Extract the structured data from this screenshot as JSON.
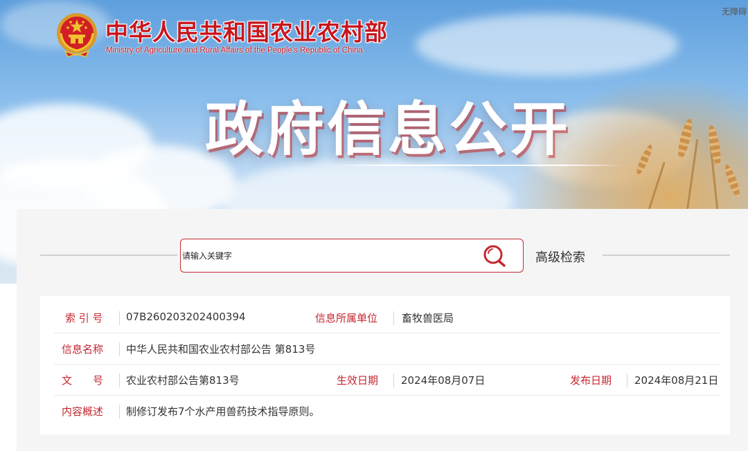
{
  "header": {
    "ministry_cn": "中华人民共和国农业农村部",
    "ministry_en": "Ministry of Agriculture and Rural Affairs of the People's Republic of China",
    "accessibility": "无障碍",
    "banner_title": "政府信息公开",
    "emblem_icon": "national-emblem-icon"
  },
  "search": {
    "placeholder": "请输入关键字",
    "button_icon": "search-icon",
    "advanced_label": "高级检索"
  },
  "info": {
    "index_label": "索 引 号",
    "index_value": "07B260203202400394",
    "unit_label": "信息所属单位",
    "unit_value": "畜牧兽医局",
    "name_label": "信息名称",
    "name_value": "中华人民共和国农业农村部公告 第813号",
    "docno_label": "文　　号",
    "docno_value": "农业农村部公告第813号",
    "effective_label": "生效日期",
    "effective_value": "2024年08月07日",
    "publish_label": "发布日期",
    "publish_value": "2024年08月21日",
    "summary_label": "内容概述",
    "summary_value": "制修订发布7个水产用兽药技术指导原则。"
  },
  "colors": {
    "brand_red": "#c8161d",
    "label_red": "#c4272f",
    "panel_bg": "#f5f5f5"
  }
}
